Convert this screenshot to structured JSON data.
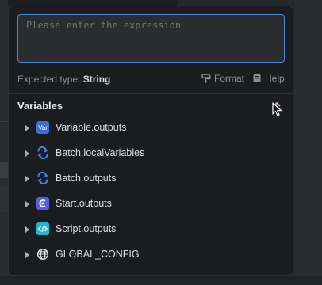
{
  "expression": {
    "value": "",
    "placeholder": "Please enter the expression"
  },
  "type_row": {
    "label": "Expected type: ",
    "value": "String",
    "format_label": "Format",
    "help_label": "Help"
  },
  "variables": {
    "title": "Variables",
    "items": [
      {
        "label": "Variable.outputs",
        "icon": "var-icon",
        "icon_text": "Var",
        "color": "#3b6fe0"
      },
      {
        "label": "Batch.localVariables",
        "icon": "loop-icon",
        "color": "#3b82f6"
      },
      {
        "label": "Batch.outputs",
        "icon": "loop-icon",
        "color": "#3b82f6"
      },
      {
        "label": "Start.outputs",
        "icon": "start-icon",
        "color": "#5b5ce6"
      },
      {
        "label": "Script.outputs",
        "icon": "code-icon",
        "color": "#22b8cf"
      },
      {
        "label": "GLOBAL_CONFIG",
        "icon": "globe-icon",
        "color": "#e6e7ea"
      }
    ]
  },
  "colors": {
    "accent": "#4c87d6",
    "panel_bg": "#1b1c20"
  }
}
